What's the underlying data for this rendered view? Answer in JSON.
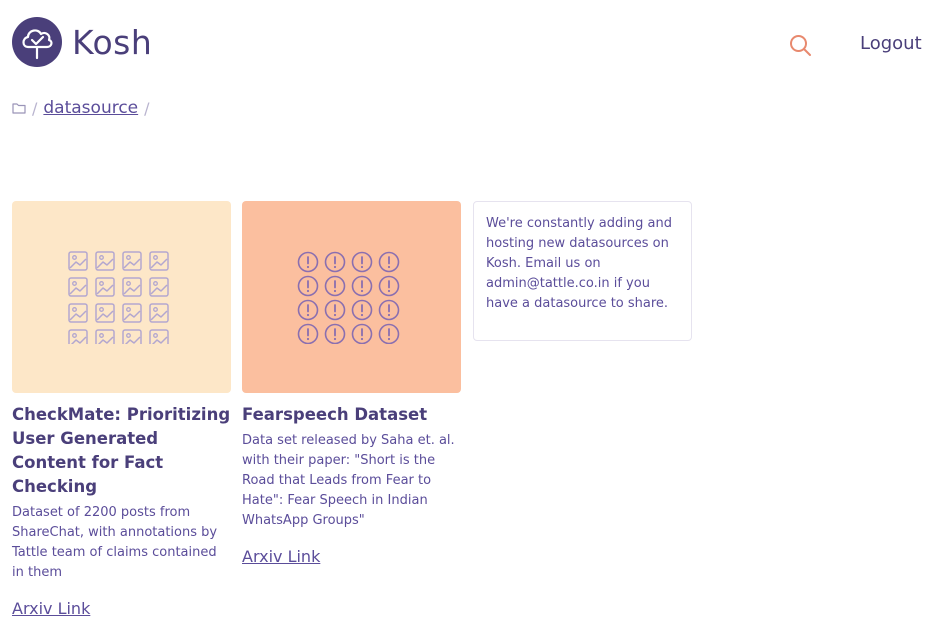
{
  "app": {
    "name": "Kosh"
  },
  "header": {
    "logout_label": "Logout"
  },
  "breadcrumb": {
    "sep1": "/",
    "link": "datasource",
    "sep2": "/"
  },
  "cards": [
    {
      "title": "CheckMate: Prioritizing User Generated Content for Fact Checking",
      "description": "Dataset of 2200 posts from ShareChat, with annotations by Tattle team of claims contained in them",
      "link_label": "Arxiv Link",
      "image_bg": "#fde7c8",
      "icon": "image-icon"
    },
    {
      "title": "Fearspeech Dataset",
      "description": "Data set released by Saha et. al. with their paper: \"Short is the Road that Leads from Fear to Hate\": Fear Speech in Indian WhatsApp Groups\"",
      "link_label": "Arxiv Link",
      "image_bg": "#fbbf9f",
      "icon": "alert-circle-icon"
    }
  ],
  "info": {
    "text": "We're constantly adding and hosting new datasources on Kosh. Email us on admin@tattle.co.in if you have a datasource to share."
  },
  "colors": {
    "primary": "#4a3f7a",
    "link": "#5b4d9a",
    "card1_bg": "#fde7c8",
    "card2_bg": "#fbbf9f"
  }
}
